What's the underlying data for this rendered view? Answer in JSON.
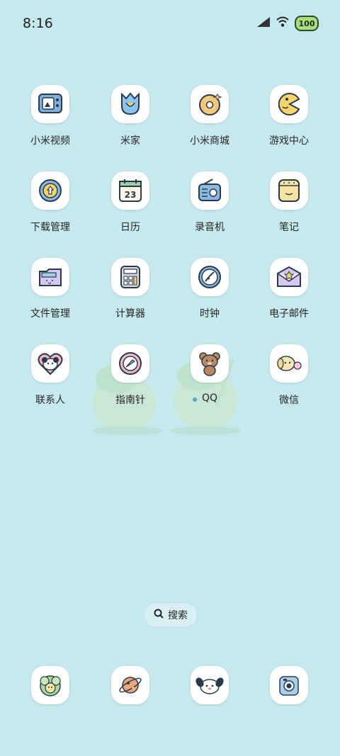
{
  "status": {
    "time": "8:16",
    "battery": "100"
  },
  "apps": [
    {
      "label": "小米视频",
      "icon": "tv-icon"
    },
    {
      "label": "米家",
      "icon": "tulip-icon"
    },
    {
      "label": "小米商城",
      "icon": "donut-icon"
    },
    {
      "label": "游戏中心",
      "icon": "pacman-icon"
    },
    {
      "label": "下载管理",
      "icon": "download-icon"
    },
    {
      "label": "日历",
      "icon": "calendar-icon"
    },
    {
      "label": "录音机",
      "icon": "radio-icon"
    },
    {
      "label": "笔记",
      "icon": "notes-icon"
    },
    {
      "label": "文件管理",
      "icon": "folder-icon"
    },
    {
      "label": "计算器",
      "icon": "calculator-icon"
    },
    {
      "label": "时钟",
      "icon": "clock-icon"
    },
    {
      "label": "电子邮件",
      "icon": "mail-icon"
    },
    {
      "label": "联系人",
      "icon": "heart-contacts-icon"
    },
    {
      "label": "指南针",
      "icon": "compass-icon"
    },
    {
      "label": "QQ",
      "icon": "bear-icon"
    },
    {
      "label": "微信",
      "icon": "puppy-icon"
    }
  ],
  "calendar_day": "23",
  "search": {
    "label": "搜索"
  },
  "dock": [
    {
      "icon": "cabbage-icon"
    },
    {
      "icon": "planet-icon"
    },
    {
      "icon": "dog-icon"
    },
    {
      "icon": "camera-icon"
    }
  ]
}
